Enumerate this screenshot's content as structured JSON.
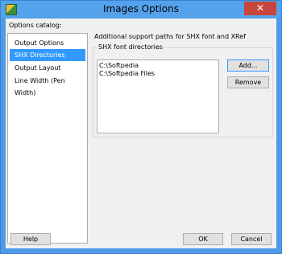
{
  "window": {
    "title": "Images Options",
    "close_glyph": "✕",
    "icon": "app-icon"
  },
  "catalog": {
    "label": "Options catalog:",
    "items": [
      {
        "label": "Output Options",
        "selected": false
      },
      {
        "label": "SHX Directories",
        "selected": true
      },
      {
        "label": "Output Layout",
        "selected": false
      },
      {
        "label": "Line Width (Pen Width)",
        "selected": false
      }
    ]
  },
  "shx": {
    "description": "Additional support paths for SHX font and XRef",
    "group_label": "SHX font directories",
    "directories": [
      "C:\\Softpedia",
      "C:\\Softpedia Files"
    ],
    "add_label": "Add...",
    "remove_label": "Remove"
  },
  "footer": {
    "help_label": "Help",
    "ok_label": "OK",
    "cancel_label": "Cancel"
  },
  "colors": {
    "title_bar": "#55a2ec",
    "selection": "#3399ff",
    "close_button": "#c7463b"
  }
}
